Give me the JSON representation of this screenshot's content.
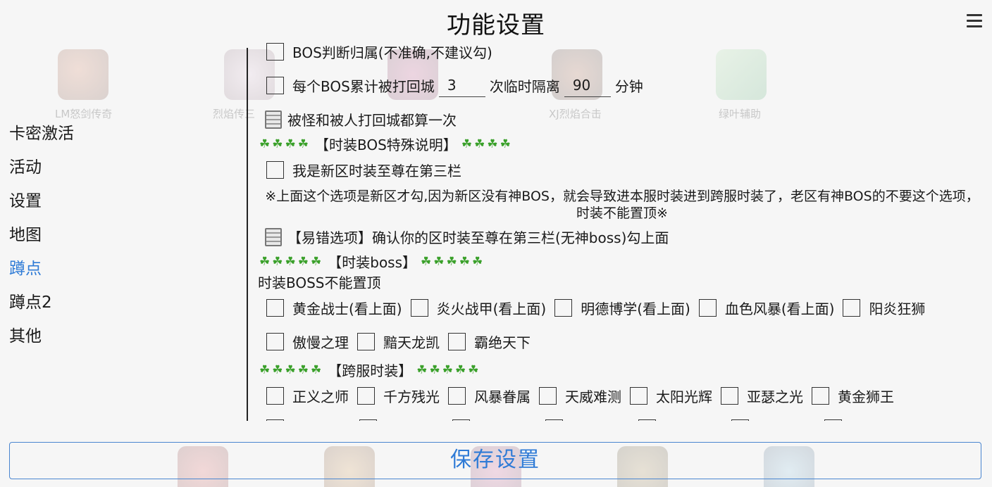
{
  "header": {
    "title": "功能设置",
    "menu_icon": "hamburger-menu-icon"
  },
  "background_apps": {
    "top": [
      "LM怒剑传奇",
      "烈焰传三",
      "",
      "XJ烈焰合击",
      "绿叶辅助"
    ],
    "bottom": [
      "",
      "",
      "",
      "",
      ""
    ]
  },
  "sidebar": {
    "items": [
      {
        "label": "卡密激活"
      },
      {
        "label": "活动"
      },
      {
        "label": "设置"
      },
      {
        "label": "地图"
      },
      {
        "label": "蹲点"
      },
      {
        "label": "蹲点2"
      },
      {
        "label": "其他"
      }
    ],
    "active_color": "#2f7bd6"
  },
  "content": {
    "boss_judge_label": "BOS判断归属(不准确,不建议勾)",
    "return_city": {
      "prefix": "每个BOS累计被打回城",
      "times_value": "3",
      "middle": "次临时隔离",
      "minutes_value": "90",
      "suffix": "分钟"
    },
    "note_return": "被怪和被人打回城都算一次",
    "section_fashion_boss_note": "【时装BOS特殊说明】",
    "new_zone_label": "我是新区时装至尊在第三栏",
    "warning_text": "※上面这个选项是新区才勾,因为新区没有神BOS，就会导致进本服时装进到跨服时装了，老区有神BOS的不要这个选项，时装不能置顶※",
    "error_option_text": "【易错选项】确认你的区时装至尊在第三栏(无神boss)勾上面",
    "section_fashion_boss": "【时装boss】",
    "cannot_pin_text": "时装BOSS不能置顶",
    "fashion_boss_row1": [
      "黄金战士(看上面)",
      "炎火战甲(看上面)",
      "明德博学(看上面)",
      "血色风暴(看上面)",
      "阳炎狂狮"
    ],
    "fashion_boss_row2": [
      "傲慢之理",
      "黯天龙凯",
      "霸绝天下"
    ],
    "section_cross_server": "【跨服时装】",
    "cross_row1": [
      "正义之师",
      "千方残光",
      "风暴眷属",
      "天威难测",
      "太阳光辉",
      "亚瑟之光",
      "黄金狮王"
    ]
  },
  "save_button": {
    "label": "保存设置"
  },
  "colors": {
    "accent": "#2f7bd6",
    "clover": "#3aa02a",
    "background": "#f6f6f6"
  }
}
